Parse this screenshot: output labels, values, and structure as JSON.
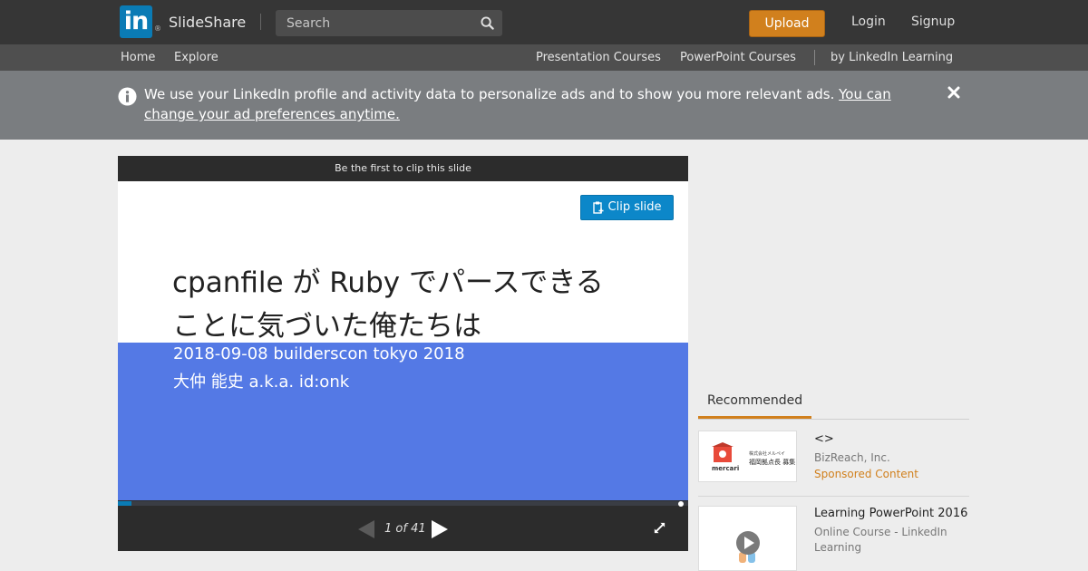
{
  "topbar": {
    "logo_mark": "in",
    "logo_reg": "®",
    "logo_text": "SlideShare",
    "search_placeholder": "Search",
    "upload_label": "Upload",
    "login_label": "Login",
    "signup_label": "Signup"
  },
  "subnav": {
    "home": "Home",
    "explore": "Explore",
    "presentation_courses": "Presentation Courses",
    "powerpoint_courses": "PowerPoint Courses",
    "linkedin_learning": "by LinkedIn Learning"
  },
  "notice": {
    "text": "We use your LinkedIn profile and activity data to personalize ads and to show you more relevant ads. ",
    "link": "You can change your ad preferences anytime."
  },
  "player": {
    "clip_bar": "Be the first to clip this slide",
    "clip_button": "Clip slide",
    "slide_title_line1": "cpanfile が Ruby でパースできる",
    "slide_title_line2": "ことに気づいた俺たちは",
    "slide_sub1": "2018-09-08 builderscon tokyo 2018",
    "slide_sub2": "大仲 能史 a.k.a. id:onk",
    "page_counter": "1 of 41",
    "progress": 0.024
  },
  "recommended": {
    "tab_label": "Recommended",
    "items": [
      {
        "title": "<>",
        "subtitle": "BizReach, Inc.",
        "sponsored": "Sponsored Content",
        "thumb_logo": "mercari",
        "thumb_text_line1": "株式会社メルペイ",
        "thumb_text_line2": "福岡拠点長 募集"
      },
      {
        "title": "Learning PowerPoint 2016",
        "subtitle": "Online Course - LinkedIn Learning"
      }
    ]
  },
  "colors": {
    "topbar": "#363636",
    "subnav": "#4f4f4f",
    "notice": "#7a7d80",
    "upload": "#d1801d",
    "clip_button": "#0c87c9",
    "slide_blue": "#5479e5"
  }
}
